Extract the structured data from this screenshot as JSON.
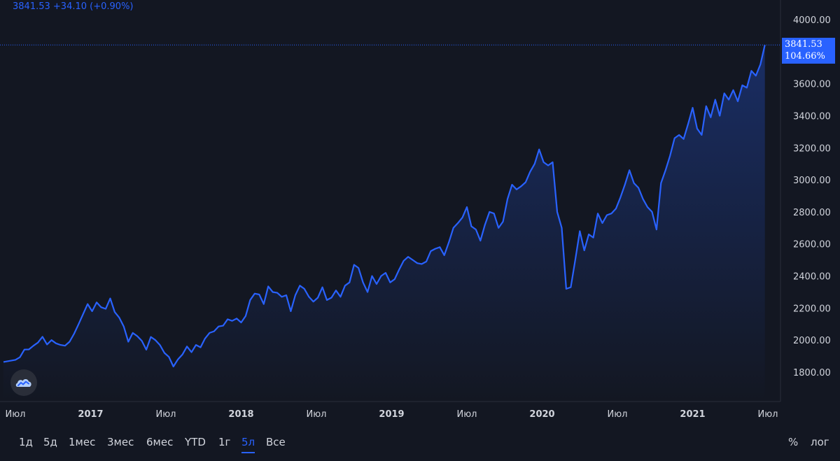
{
  "header": {
    "price": "3841.53",
    "change": "+34.10",
    "change_pct": "(+0.90%)"
  },
  "price_box": {
    "price": "3841.53",
    "pct": "104.66%"
  },
  "colors": {
    "background": "#131722",
    "line": "#2962ff",
    "text": "#d1d4dc",
    "accent": "#2962ff"
  },
  "toolbar": {
    "ranges": [
      "1д",
      "5д",
      "1мес",
      "3мес",
      "6мес",
      "YTD",
      "1г",
      "5л",
      "Все"
    ],
    "active_range": "5л",
    "percent_label": "%",
    "log_label": "лог"
  },
  "logo_icon": "cloud-chart-icon",
  "chart_data": {
    "type": "area",
    "y_ticks": [
      1800,
      2000,
      2200,
      2400,
      2600,
      2800,
      3000,
      3200,
      3400,
      3600,
      4000
    ],
    "y_tick_labels": [
      "1800.00",
      "2000.00",
      "2200.00",
      "2400.00",
      "2600.00",
      "2800.00",
      "3000.00",
      "3200.00",
      "3400.00",
      "3600.00",
      "4000.00"
    ],
    "ylim": [
      1610,
      4110
    ],
    "xlim": [
      2016.5,
      2021.95
    ],
    "x_ticks": [
      {
        "x": 2016.5,
        "label": "Июл",
        "major": false
      },
      {
        "x": 2017.0,
        "label": "2017",
        "major": true
      },
      {
        "x": 2017.5,
        "label": "Июл",
        "major": false
      },
      {
        "x": 2018.0,
        "label": "2018",
        "major": true
      },
      {
        "x": 2018.5,
        "label": "Июл",
        "major": false
      },
      {
        "x": 2019.0,
        "label": "2019",
        "major": true
      },
      {
        "x": 2019.5,
        "label": "Июл",
        "major": false
      },
      {
        "x": 2020.0,
        "label": "2020",
        "major": true
      },
      {
        "x": 2020.5,
        "label": "Июл",
        "major": false
      },
      {
        "x": 2021.0,
        "label": "2021",
        "major": true
      },
      {
        "x": 2021.5,
        "label": "Июл",
        "major": false
      }
    ],
    "last_value": 3841.53,
    "grid": false,
    "series": [
      {
        "points": [
          [
            2016.5,
            1877
          ],
          [
            2016.53,
            1893
          ],
          [
            2016.56,
            1941
          ],
          [
            2016.59,
            1942
          ],
          [
            2016.62,
            1965
          ],
          [
            2016.65,
            1985
          ],
          [
            2016.68,
            2021
          ],
          [
            2016.71,
            1973
          ],
          [
            2016.74,
            2000
          ],
          [
            2016.77,
            1980
          ],
          [
            2016.8,
            1970
          ],
          [
            2016.83,
            1965
          ],
          [
            2016.86,
            1990
          ],
          [
            2016.89,
            2040
          ],
          [
            2016.92,
            2100
          ],
          [
            2016.95,
            2163
          ],
          [
            2016.98,
            2225
          ],
          [
            2017.01,
            2180
          ],
          [
            2017.04,
            2235
          ],
          [
            2017.07,
            2205
          ],
          [
            2017.1,
            2195
          ],
          [
            2017.13,
            2260
          ],
          [
            2017.16,
            2175
          ],
          [
            2017.19,
            2140
          ],
          [
            2017.22,
            2085
          ],
          [
            2017.25,
            1990
          ],
          [
            2017.28,
            2045
          ],
          [
            2017.31,
            2025
          ],
          [
            2017.34,
            1995
          ],
          [
            2017.37,
            1940
          ],
          [
            2017.4,
            2020
          ],
          [
            2017.43,
            2000
          ],
          [
            2017.46,
            1970
          ],
          [
            2017.49,
            1920
          ],
          [
            2017.52,
            1895
          ],
          [
            2017.55,
            1835
          ],
          [
            2017.58,
            1880
          ],
          [
            2017.61,
            1910
          ],
          [
            2017.64,
            1960
          ],
          [
            2017.67,
            1925
          ],
          [
            2017.7,
            1970
          ],
          [
            2017.73,
            1955
          ],
          [
            2017.76,
            2010
          ],
          [
            2017.79,
            2045
          ],
          [
            2017.82,
            2055
          ],
          [
            2017.85,
            2085
          ],
          [
            2017.88,
            2090
          ],
          [
            2017.91,
            2130
          ],
          [
            2017.94,
            2120
          ],
          [
            2017.97,
            2135
          ],
          [
            2018.0,
            2110
          ],
          [
            2018.03,
            2150
          ],
          [
            2018.06,
            2250
          ],
          [
            2018.09,
            2290
          ],
          [
            2018.12,
            2285
          ],
          [
            2018.15,
            2225
          ],
          [
            2018.18,
            2335
          ],
          [
            2018.21,
            2300
          ],
          [
            2018.24,
            2295
          ],
          [
            2018.27,
            2270
          ],
          [
            2018.3,
            2280
          ],
          [
            2018.33,
            2180
          ],
          [
            2018.36,
            2280
          ],
          [
            2018.39,
            2340
          ],
          [
            2018.42,
            2320
          ],
          [
            2018.45,
            2270
          ],
          [
            2018.48,
            2240
          ],
          [
            2018.51,
            2265
          ],
          [
            2018.54,
            2330
          ],
          [
            2018.57,
            2250
          ],
          [
            2018.6,
            2265
          ],
          [
            2018.63,
            2310
          ],
          [
            2018.66,
            2270
          ],
          [
            2018.69,
            2340
          ],
          [
            2018.72,
            2360
          ],
          [
            2018.75,
            2470
          ],
          [
            2018.78,
            2450
          ],
          [
            2018.81,
            2360
          ],
          [
            2018.84,
            2300
          ],
          [
            2018.87,
            2400
          ],
          [
            2018.9,
            2350
          ],
          [
            2018.93,
            2400
          ],
          [
            2018.96,
            2420
          ],
          [
            2018.99,
            2360
          ],
          [
            2019.02,
            2380
          ],
          [
            2019.05,
            2440
          ],
          [
            2019.08,
            2495
          ],
          [
            2019.11,
            2520
          ],
          [
            2019.14,
            2500
          ],
          [
            2019.17,
            2480
          ],
          [
            2019.2,
            2475
          ],
          [
            2019.23,
            2490
          ],
          [
            2019.26,
            2555
          ],
          [
            2019.29,
            2570
          ],
          [
            2019.32,
            2580
          ],
          [
            2019.35,
            2530
          ],
          [
            2019.38,
            2610
          ],
          [
            2019.41,
            2700
          ],
          [
            2019.44,
            2730
          ],
          [
            2019.47,
            2765
          ],
          [
            2019.5,
            2830
          ],
          [
            2019.53,
            2710
          ],
          [
            2019.56,
            2690
          ],
          [
            2019.59,
            2620
          ],
          [
            2019.62,
            2720
          ],
          [
            2019.65,
            2800
          ],
          [
            2019.68,
            2790
          ],
          [
            2019.71,
            2700
          ],
          [
            2019.74,
            2740
          ],
          [
            2019.77,
            2880
          ],
          [
            2019.8,
            2970
          ],
          [
            2019.83,
            2940
          ],
          [
            2019.86,
            2960
          ],
          [
            2019.89,
            2985
          ],
          [
            2019.92,
            3050
          ],
          [
            2019.95,
            3100
          ],
          [
            2019.98,
            3190
          ],
          [
            2020.01,
            3110
          ],
          [
            2020.04,
            3090
          ],
          [
            2020.07,
            3110
          ],
          [
            2020.1,
            2800
          ],
          [
            2020.13,
            2700
          ],
          [
            2020.16,
            2320
          ],
          [
            2020.19,
            2330
          ],
          [
            2020.22,
            2500
          ],
          [
            2020.25,
            2680
          ],
          [
            2020.28,
            2560
          ],
          [
            2020.31,
            2660
          ],
          [
            2020.34,
            2640
          ],
          [
            2020.37,
            2790
          ],
          [
            2020.4,
            2730
          ],
          [
            2020.43,
            2780
          ],
          [
            2020.46,
            2790
          ],
          [
            2020.49,
            2820
          ],
          [
            2020.52,
            2890
          ],
          [
            2020.55,
            2970
          ],
          [
            2020.58,
            3060
          ],
          [
            2020.61,
            2980
          ],
          [
            2020.64,
            2950
          ],
          [
            2020.67,
            2880
          ],
          [
            2020.7,
            2830
          ],
          [
            2020.73,
            2800
          ],
          [
            2020.76,
            2690
          ],
          [
            2020.79,
            2980
          ],
          [
            2020.82,
            3060
          ],
          [
            2020.85,
            3150
          ],
          [
            2020.88,
            3260
          ],
          [
            2020.91,
            3280
          ],
          [
            2020.94,
            3255
          ],
          [
            2020.97,
            3350
          ],
          [
            2021.0,
            3450
          ],
          [
            2021.03,
            3320
          ],
          [
            2021.06,
            3280
          ],
          [
            2021.09,
            3460
          ],
          [
            2021.12,
            3390
          ],
          [
            2021.15,
            3500
          ],
          [
            2021.18,
            3400
          ],
          [
            2021.21,
            3540
          ],
          [
            2021.24,
            3500
          ],
          [
            2021.27,
            3560
          ],
          [
            2021.3,
            3490
          ],
          [
            2021.33,
            3590
          ],
          [
            2021.36,
            3575
          ],
          [
            2021.39,
            3680
          ],
          [
            2021.42,
            3650
          ],
          [
            2021.45,
            3720
          ],
          [
            2021.48,
            3841.53
          ]
        ]
      }
    ]
  }
}
